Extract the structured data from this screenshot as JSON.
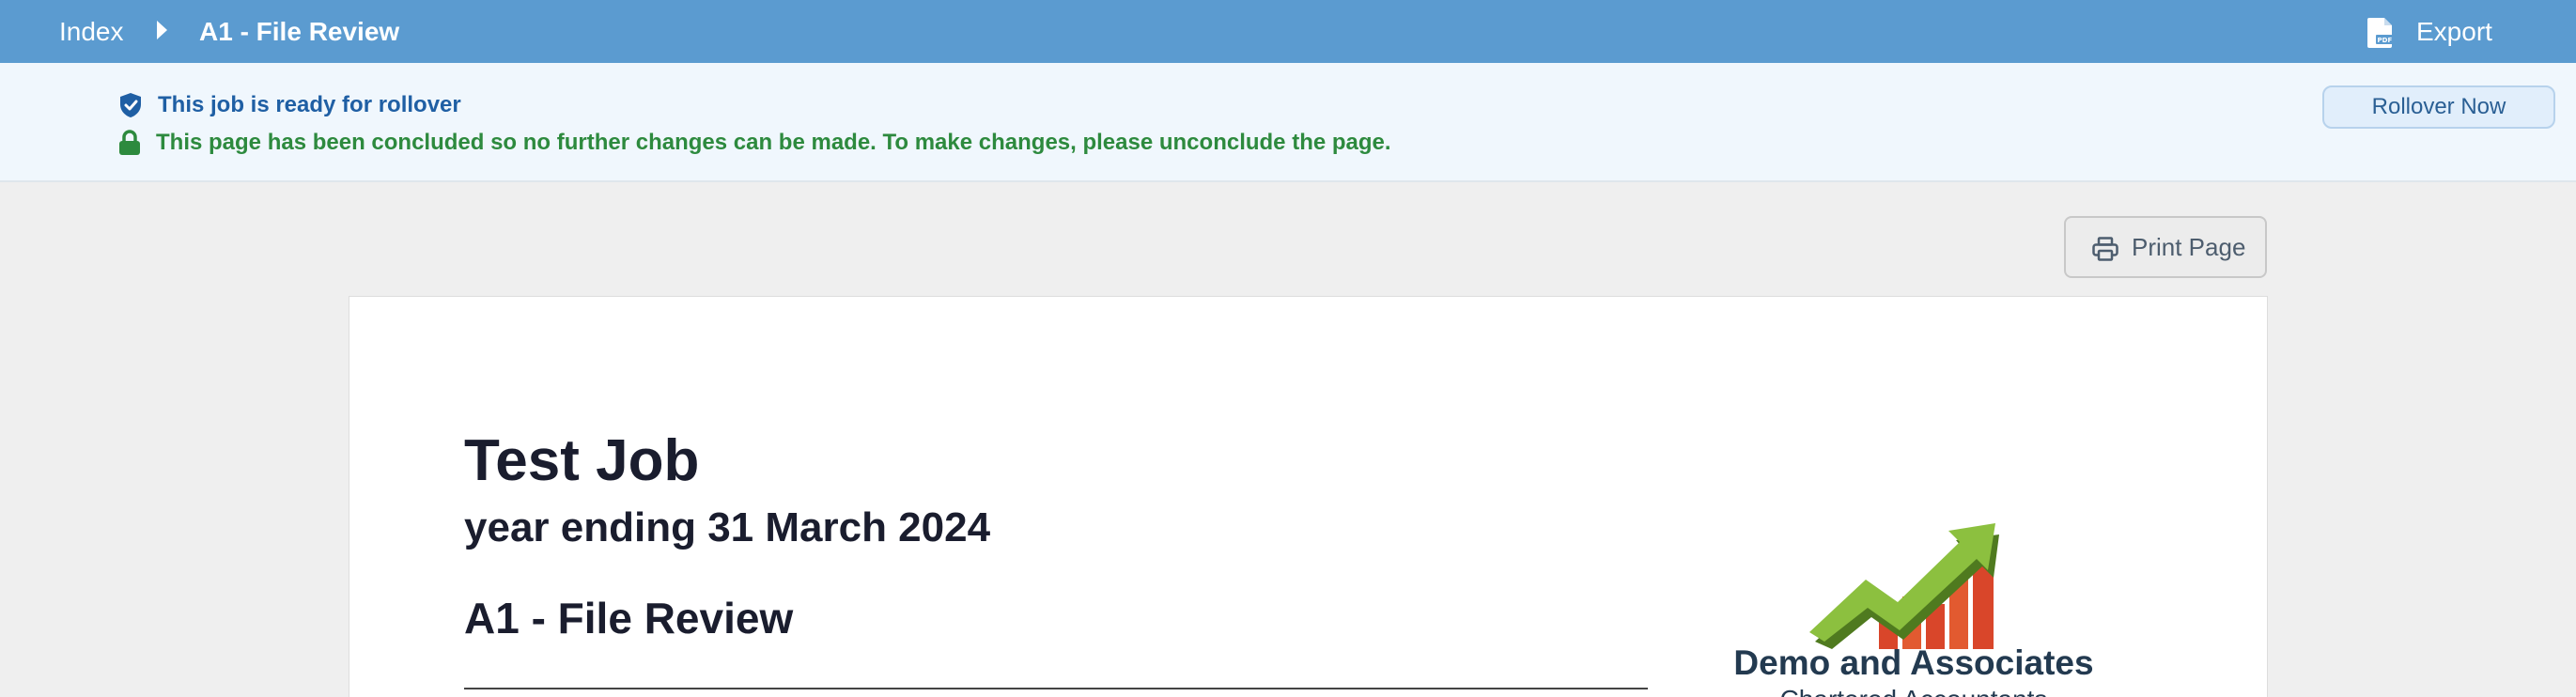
{
  "topbar": {
    "breadcrumb_index": "Index",
    "breadcrumb_current": "A1 - File Review",
    "export_label": "Export",
    "export_icon": "pdf-file-icon",
    "background": "#5b9bd0"
  },
  "banner": {
    "rollover_message": "This job is ready for rollover",
    "concluded_message": "This page has been concluded so no further changes can be made. To make changes, please unconclude the page.",
    "rollover_button": "Rollover Now",
    "rollover_icon": "shield-check-icon",
    "concluded_icon": "lock-icon",
    "rollover_color": "#1f5fa4",
    "concluded_color": "#2d8a3e"
  },
  "toolbar": {
    "print_label": "Print Page",
    "print_icon": "printer-icon"
  },
  "document": {
    "title": "Test Job",
    "subtitle": "year ending 31 March 2024",
    "section": "A1 - File Review"
  },
  "logo": {
    "name": "Demo and Associates",
    "tagline": "Chartered Accountants"
  }
}
